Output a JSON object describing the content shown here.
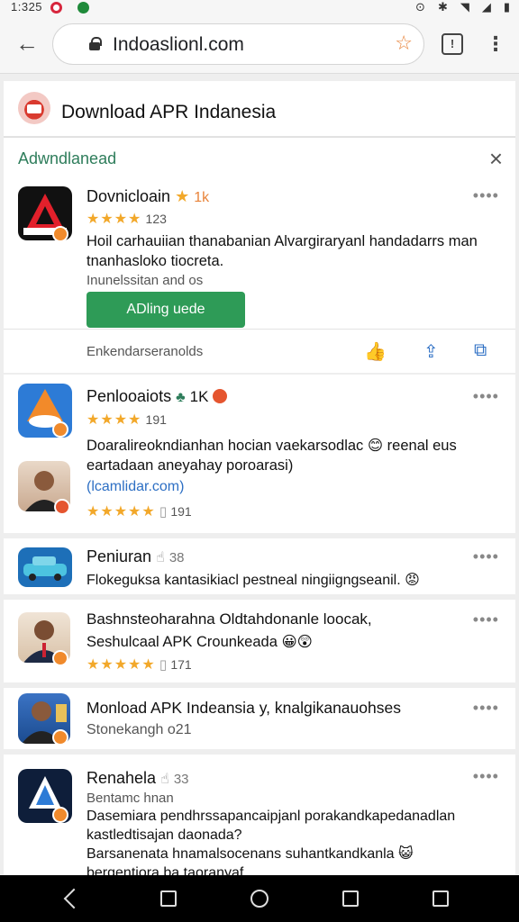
{
  "status_bar": {
    "time": "1:325"
  },
  "toolbar": {
    "url": "Indoaslionl.com"
  },
  "site": {
    "title": "Download APR Indanesia"
  },
  "ad_card": {
    "header": "Adwndlanead",
    "app_title": "Dovnicloain",
    "size_tag": "1k",
    "rating_count": "123",
    "desc_line1": "Hoil carhauiian thanabanian Alvargiraryanl handadarrs man",
    "desc_line2": "tnanhasloko tiocreta.",
    "desc_line3": "Inunelssitan and os",
    "install_label": "ADling uede",
    "footer": "Enkendarseranolds"
  },
  "results": [
    {
      "title": "Penlooaiots",
      "count": "1K",
      "rating_count": "191",
      "desc_line1": "Doaralireokndianhan hocian vaekarsodlac",
      "desc_line1b": "reenal eus",
      "desc_line2": "eartadaan aneyahay poroarasi)",
      "link": "(lcamlidar.com)",
      "sub_rating_count": "191"
    },
    {
      "title": "Peniuran",
      "count": "38",
      "desc": "Flokeguksa kantasikiacl pestneal ningiigngseanil."
    },
    {
      "title": "Bashnsteoharahna Oldtahdonanle loocak,",
      "subtitle": "Seshulcaal APK Crounkeada",
      "rating_count": "171"
    },
    {
      "title": "Monload APK Indeansia",
      "title_tail": "y, knalgikanauohses",
      "subtitle": "Stonekangh o21"
    },
    {
      "title": "Renahela",
      "count": "33",
      "subtitle": "Bentamc hnan",
      "desc_line1": "Dasemiara pendhrssapancaipjanl porakandkapedanadlan",
      "desc_line2": "kastledtisajan daonada?",
      "desc_line3": "Barsanenata hnamalsocenans suhantkandkanla",
      "desc_line4": "bergentiora ba taoranyaf"
    }
  ],
  "colors": {
    "accent_green": "#2e9b57",
    "link_blue": "#2d6fc4",
    "star_gold": "#f2a82a"
  }
}
